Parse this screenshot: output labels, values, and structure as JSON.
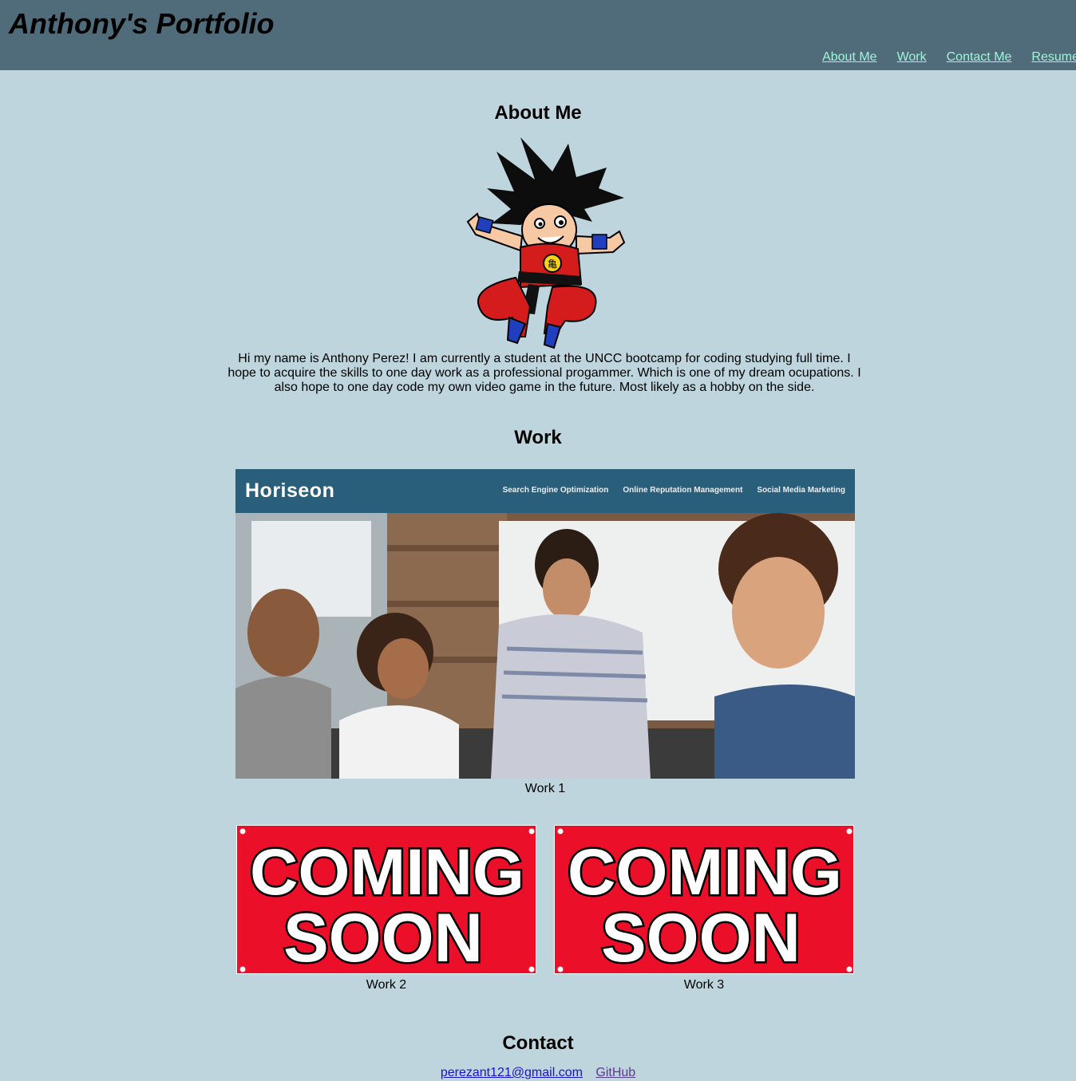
{
  "header": {
    "title": "Anthony's Portfolio",
    "nav": [
      "About Me",
      "Work",
      "Contact Me",
      "Resume"
    ]
  },
  "about": {
    "heading": "About Me",
    "avatar_icon": "cartoon-character-avatar",
    "bio": "Hi my name is Anthony Perez! I am currently a student at the UNCC bootcamp for coding studying full time. I hope to acquire the skills to one day work as a professional progammer. Which is one of my dream ocupations. I also hope to one day code my own video game in the future. Most likely as a hobby on the side."
  },
  "work": {
    "heading": "Work",
    "items": [
      {
        "caption": "Work 1",
        "screenshot": {
          "logo": "Horiseon",
          "menu": [
            "Search Engine Optimization",
            "Online Reputation Management",
            "Social Media Marketing"
          ]
        }
      },
      {
        "caption": "Work 2",
        "banner": [
          "COMING",
          "SOON"
        ]
      },
      {
        "caption": "Work 3",
        "banner": [
          "COMING",
          "SOON"
        ]
      }
    ]
  },
  "contact": {
    "heading": "Contact",
    "email": "perezant121@gmail.com",
    "github": "GitHub"
  },
  "colors": {
    "page_bg": "#bed5de",
    "header_bg": "#506c7a",
    "nav_link": "#9ff5d8",
    "banner_red": "#ec0f2a"
  }
}
